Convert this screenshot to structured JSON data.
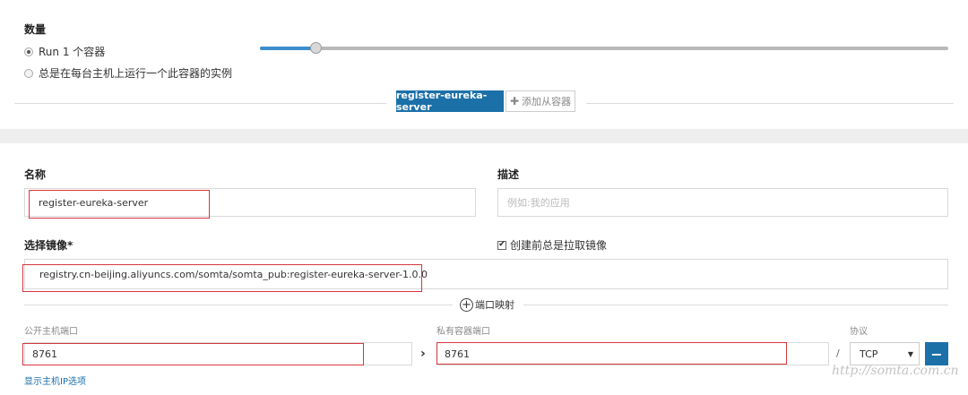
{
  "quantity": {
    "heading": "数量",
    "option_run": "Run 1 个容器",
    "option_every_host": "总是在每台主机上运行一个此容器的实例",
    "slider_value": 1
  },
  "tabs": {
    "active": "register-eureka-server",
    "add_label": "添加从容器"
  },
  "form": {
    "name_label": "名称",
    "name_value": "register-eureka-server",
    "desc_label": "描述",
    "desc_placeholder": "例如:我的应用",
    "image_label": "选择镜像*",
    "pull_label": "创建前总是拉取镜像",
    "image_value": "registry.cn-beijing.aliyuncs.com/somta/somta_pub:register-eureka-server-1.0.0",
    "port_map_label": "端口映射",
    "public_port_label": "公开主机端口",
    "public_port_value": "8761",
    "private_port_label": "私有容器端口",
    "private_port_value": "8761",
    "slash": "/",
    "protocol_label": "协议",
    "protocol_value": "TCP",
    "minus_label": "−",
    "show_host_ip": "显示主机IP选项"
  },
  "watermark": "http://somta.com.cn",
  "icons": {
    "arrow": "chevron-right-icon",
    "plus": "plus-icon",
    "dropdown": "caret-down-icon"
  },
  "colors": {
    "accent": "#1b70a8",
    "highlight": "#d9363e"
  }
}
